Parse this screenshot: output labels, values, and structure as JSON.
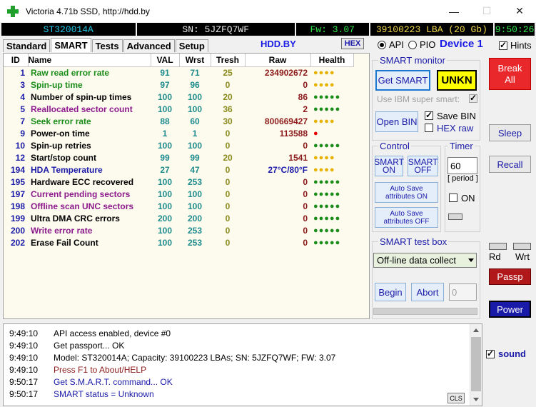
{
  "window": {
    "title": "Victoria 4.71b SSD, http://hdd.by",
    "minimize": "—",
    "maximize": "☐",
    "close": "✕"
  },
  "infobar": {
    "model": "ST320014A",
    "sn": "SN: 5JZFQ7WF",
    "fw": "Fw: 3.07",
    "lba": "39100223 LBA (20 Gb)",
    "time": "9:50:26"
  },
  "tabs": [
    "Standard",
    "SMART",
    "Tests",
    "Advanced",
    "Setup"
  ],
  "toolbar": {
    "site": "HDD.BY",
    "hex": "HEX",
    "api": "API",
    "pio": "PIO",
    "device": "Device 1",
    "hints": "Hints"
  },
  "smart_table": {
    "headers": [
      "ID",
      "Name",
      "VAL",
      "Wrst",
      "Tresh",
      "Raw",
      "Health"
    ],
    "rows": [
      {
        "id": "1",
        "name": "Raw read error rate",
        "val": "91",
        "wrst": "71",
        "tresh": "25",
        "raw": "234902672",
        "health": "●●●●",
        "name_color": "#1a8c1a",
        "health_color": "#e6b400"
      },
      {
        "id": "3",
        "name": "Spin-up time",
        "val": "97",
        "wrst": "96",
        "tresh": "0",
        "raw": "0",
        "health": "●●●●",
        "name_color": "#1a8c1a",
        "health_color": "#e6b400"
      },
      {
        "id": "4",
        "name": "Number of spin-up times",
        "val": "100",
        "wrst": "100",
        "tresh": "20",
        "raw": "86",
        "health": "●●●●●",
        "name_color": "#000000",
        "health_color": "#1a8c1a"
      },
      {
        "id": "5",
        "name": "Reallocated sector count",
        "val": "100",
        "wrst": "100",
        "tresh": "36",
        "raw": "2",
        "health": "●●●●●",
        "name_color": "#8c1a8c",
        "health_color": "#1a8c1a"
      },
      {
        "id": "7",
        "name": "Seek error rate",
        "val": "88",
        "wrst": "60",
        "tresh": "30",
        "raw": "800669427",
        "health": "●●●●",
        "name_color": "#1a8c1a",
        "health_color": "#e6b400"
      },
      {
        "id": "9",
        "name": "Power-on time",
        "val": "1",
        "wrst": "1",
        "tresh": "0",
        "raw": "113588",
        "health": "●",
        "name_color": "#000000",
        "health_color": "#e60000"
      },
      {
        "id": "10",
        "name": "Spin-up retries",
        "val": "100",
        "wrst": "100",
        "tresh": "0",
        "raw": "0",
        "health": "●●●●●",
        "name_color": "#000000",
        "health_color": "#1a8c1a"
      },
      {
        "id": "12",
        "name": "Start/stop count",
        "val": "99",
        "wrst": "99",
        "tresh": "20",
        "raw": "1541",
        "health": "●●●●",
        "name_color": "#000000",
        "health_color": "#e6b400"
      },
      {
        "id": "194",
        "name": "HDA Temperature",
        "val": "27",
        "wrst": "47",
        "tresh": "0",
        "raw": "27°C/80°F",
        "health": "●●●●",
        "name_color": "#1a1aa8",
        "health_color": "#e6b400",
        "raw_color": "#1a1aa8"
      },
      {
        "id": "195",
        "name": "Hardware ECC recovered",
        "val": "100",
        "wrst": "253",
        "tresh": "0",
        "raw": "0",
        "health": "●●●●●",
        "name_color": "#000000",
        "health_color": "#1a8c1a"
      },
      {
        "id": "197",
        "name": "Current pending sectors",
        "val": "100",
        "wrst": "100",
        "tresh": "0",
        "raw": "0",
        "health": "●●●●●",
        "name_color": "#8c1a8c",
        "health_color": "#1a8c1a"
      },
      {
        "id": "198",
        "name": "Offline scan UNC sectors",
        "val": "100",
        "wrst": "100",
        "tresh": "0",
        "raw": "0",
        "health": "●●●●●",
        "name_color": "#8c1a8c",
        "health_color": "#1a8c1a"
      },
      {
        "id": "199",
        "name": "Ultra DMA CRC errors",
        "val": "200",
        "wrst": "200",
        "tresh": "0",
        "raw": "0",
        "health": "●●●●●",
        "name_color": "#000000",
        "health_color": "#1a8c1a"
      },
      {
        "id": "200",
        "name": "Write error rate",
        "val": "100",
        "wrst": "253",
        "tresh": "0",
        "raw": "0",
        "health": "●●●●●",
        "name_color": "#8c1a8c",
        "health_color": "#1a8c1a"
      },
      {
        "id": "202",
        "name": "Erase Fail Count",
        "val": "100",
        "wrst": "253",
        "tresh": "0",
        "raw": "0",
        "health": "●●●●●",
        "name_color": "#000000",
        "health_color": "#1a8c1a"
      }
    ]
  },
  "smart_monitor": {
    "title": "SMART monitor",
    "get_smart": "Get SMART",
    "status": "UNKN",
    "ibm": "Use IBM super smart:",
    "open_bin": "Open BIN",
    "save_bin": "Save BIN",
    "hex_raw": "HEX raw"
  },
  "control": {
    "title": "Control",
    "smart_on": "SMART ON",
    "smart_off": "SMART OFF",
    "autosave_on": "Auto Save attributes ON",
    "autosave_off": "Auto Save attributes OFF"
  },
  "timer": {
    "title": "Timer",
    "value": "60",
    "period": "[ period ]",
    "on": "ON"
  },
  "test_box": {
    "title": "SMART test box",
    "selected": "Off-line data collect",
    "begin": "Begin",
    "abort": "Abort",
    "value": "0"
  },
  "right": {
    "break": "Break All",
    "sleep": "Sleep",
    "recall": "Recall",
    "rd": "Rd",
    "wrt": "Wrt",
    "passp": "Passp",
    "power": "Power",
    "sound": "sound"
  },
  "log": [
    {
      "time": "9:49:10",
      "text": "API access enabled, device #0",
      "color": "#000000"
    },
    {
      "time": "9:49:10",
      "text": "Get passport... OK",
      "color": "#000000"
    },
    {
      "time": "9:49:10",
      "text": "Model: ST320014A; Capacity: 39100223 LBAs; SN: 5JZFQ7WF; FW: 3.07",
      "color": "#000000"
    },
    {
      "time": "9:49:10",
      "text": "Press F1 to About/HELP",
      "color": "#8c1a1a"
    },
    {
      "time": "9:50:17",
      "text": "Get S.M.A.R.T. command... OK",
      "color": "#1a1aa8"
    },
    {
      "time": "9:50:17",
      "text": "SMART status = Unknown",
      "color": "#1a1aa8"
    }
  ],
  "cls": "CLS"
}
